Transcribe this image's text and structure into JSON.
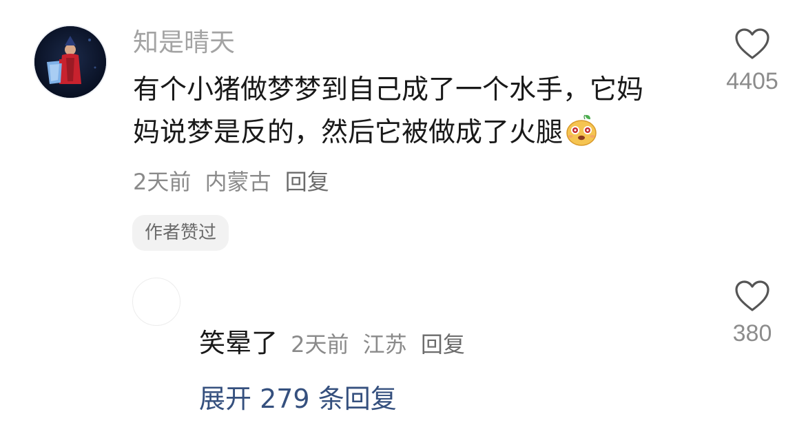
{
  "comment": {
    "username": "知是晴天",
    "text_line1": "有个小猪做梦梦到自己成了一个水手，它妈",
    "text_line2": "妈说梦是反的，然后它被做成了火腿",
    "emoji": "pig-face-emoji",
    "time": "2天前",
    "location": "内蒙古",
    "reply_label": "回复",
    "author_badge": "作者赞过",
    "likes": "4405"
  },
  "reply": {
    "text": "笑晕了",
    "time": "2天前",
    "location": "江苏",
    "reply_label": "回复",
    "likes": "380"
  },
  "expand_label": "展开 279 条回复",
  "icons": {
    "like": "heart-outline-icon",
    "avatar": "user-avatar-photo"
  },
  "colors": {
    "username": "#a3a3a3",
    "meta": "#8a8a8a",
    "expand_link": "#35507e",
    "badge_bg": "#f2f2f2"
  }
}
